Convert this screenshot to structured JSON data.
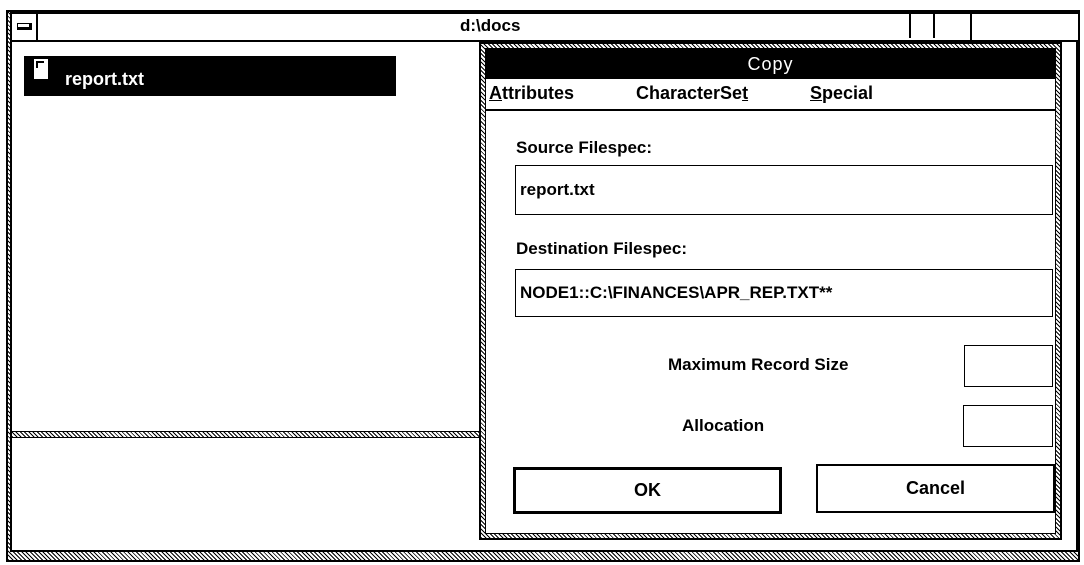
{
  "background_window": {
    "title": "d:\\docs",
    "files": [
      {
        "name": "report.txt",
        "selected": true,
        "icon": "document-icon"
      }
    ]
  },
  "dialog": {
    "title": "Copy",
    "menu": [
      {
        "label": "Attributes",
        "mnemonic": "A"
      },
      {
        "label": "CharacterSet",
        "mnemonic": "t"
      },
      {
        "label": "Special",
        "mnemonic": "S"
      }
    ],
    "source": {
      "label": "Source Filespec:",
      "value": "report.txt"
    },
    "destination": {
      "label": "Destination Filespec:",
      "value": "NODE1::C:\\FINANCES\\APR_REP.TXT**"
    },
    "max_record_size": {
      "label": "Maximum Record Size",
      "value": ""
    },
    "allocation": {
      "label": "Allocation",
      "value": ""
    },
    "ok_label": "OK",
    "cancel_label": "Cancel"
  },
  "colors": {
    "foreground": "#000000",
    "background": "#ffffff",
    "selection": "#000000"
  }
}
